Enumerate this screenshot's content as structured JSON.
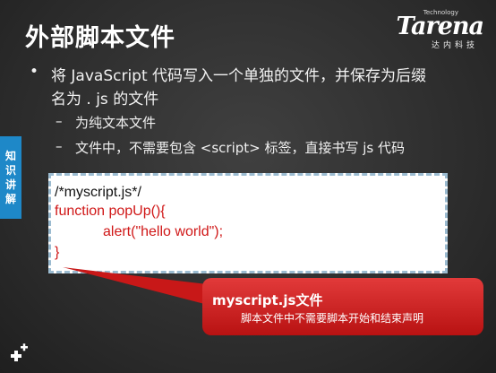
{
  "slide": {
    "title": "外部脚本文件",
    "logo": {
      "tech": "Technology",
      "brand": "Tarena",
      "cn": "达内科技"
    },
    "bullets": [
      {
        "line1": "将 JavaScript  代码写入一个单独的文件，并保存为后缀",
        "line2": "名为 . js 的文件"
      }
    ],
    "sub_bullets": [
      "为纯文本文件",
      "文件中，不需要包含  <script> 标签，直接书写  js 代码"
    ],
    "side_tab": [
      "知",
      "识",
      "讲",
      "解"
    ],
    "code": [
      "/*myscript.js*/",
      "function popUp(){",
      "alert(\"hello world\");",
      "}"
    ],
    "callout": {
      "title": "myscript.js文件",
      "desc": "脚本文件中不需要脚本开始和结束声明"
    },
    "colors": {
      "accent_blue": "#1e88c8",
      "code_red": "#d01818",
      "callout_red": "#d32020"
    },
    "icons": {
      "bottom_left": "plus-icon"
    }
  }
}
